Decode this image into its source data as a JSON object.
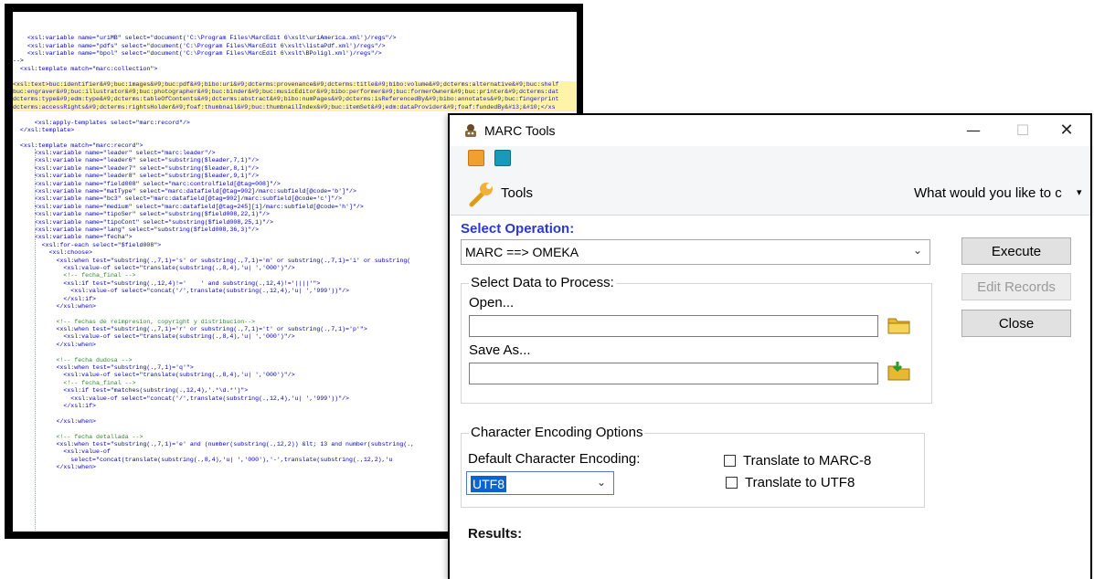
{
  "editor": {
    "lines": [
      {
        "text": "    <xsl:variable name=\"uriMB\" select=\"document('C:\\Program Files\\MarcEdit 6\\xslt\\uriAmerica.xml')/regs\"/>",
        "kind": "t"
      },
      {
        "text": "    <xsl:variable name=\"pdfs\" select=\"document('C:\\Program Files\\MarcEdit 6\\xslt\\listaPdf.xml')/regs\"/>",
        "kind": "t"
      },
      {
        "text": "    <xsl:variable name=\"bpol\" select=\"document('C:\\Program Files\\MarcEdit 6\\xslt\\BPoligl.xml')/regs\"/>",
        "kind": "t"
      },
      {
        "text": "-->",
        "kind": "b"
      },
      {
        "text": "  <xsl:template match=\"marc:collection\">",
        "kind": "t"
      },
      {
        "text": "",
        "kind": "b"
      },
      {
        "text": "<xsl:text>buc:identifier&#9;buc:images&#9;buc:pdf&#9;bibo:uri&#9;dcterms:provenance&#9;dcterms:title&#9;bibo:volume&#9;dcterms:alternative&#9;buc:shelf",
        "kind": "sel"
      },
      {
        "text": "buc:engraver&#9;buc:illustrator&#9;buc:photographer&#9;buc:binder&#9;buc:musicEditor&#9;bibo:performer&#9;buc:formerOwner&#9;buc:printer&#9;dcterms:dat",
        "kind": "sel"
      },
      {
        "text": "dcterms:type&#9;edm:type&#9;dcterms:tableOfContents&#9;dcterms:abstract&#9;bibo:numPages&#9;dcterms:isReferencedBy&#9;bibo:annotates&#9;buc:fingerprint",
        "kind": "sel"
      },
      {
        "text": "dcterms:accessRights&#9;dcterms:rightsHolder&#9;foaf:thumbnail&#9;buc:thumbnailIndex&#9;buc:itemSet&#9;edm:dataProvider&#9;foaf:fundedBy&#13;&#10;</xs",
        "kind": "sel"
      },
      {
        "text": "",
        "kind": "b"
      },
      {
        "text": "      <xsl:apply-templates select=\"marc:record\"/>",
        "kind": "t"
      },
      {
        "text": "  </xsl:template>",
        "kind": "t"
      },
      {
        "text": "",
        "kind": "b"
      },
      {
        "text": "  <xsl:template match=\"marc:record\">",
        "kind": "t"
      },
      {
        "text": "      <xsl:variable name=\"leader\" select=\"marc:leader\"/>",
        "kind": "t"
      },
      {
        "text": "      <xsl:variable name=\"leader6\" select=\"substring($leader,7,1)\"/>",
        "kind": "t"
      },
      {
        "text": "      <xsl:variable name=\"leader7\" select=\"substring($leader,8,1)\"/>",
        "kind": "t"
      },
      {
        "text": "      <xsl:variable name=\"leader8\" select=\"substring($leader,9,1)\"/>",
        "kind": "t"
      },
      {
        "text": "      <xsl:variable name=\"field008\" select=\"marc:controlfield[@tag=008]\"/>",
        "kind": "t"
      },
      {
        "text": "      <xsl:variable name=\"matType\" select=\"marc:datafield[@tag=902]/marc:subfield[@code='b']\"/>",
        "kind": "t"
      },
      {
        "text": "      <xsl:variable name=\"bc3\" select=\"marc:datafield[@tag=902]/marc:subfield[@code='c']\"/>",
        "kind": "t"
      },
      {
        "text": "      <xsl:variable name=\"medium\" select=\"marc:datafield[@tag=245][1]/marc:subfield[@code='h']\"/>",
        "kind": "t"
      },
      {
        "text": "      <xsl:variable name=\"tipoSer\" select=\"substring($field008,22,1)\"/>",
        "kind": "t"
      },
      {
        "text": "      <xsl:variable name=\"tipoCont\" select=\"substring($field008,25,1)\"/>",
        "kind": "t"
      },
      {
        "text": "      <xsl:variable name=\"lang\" select=\"substring($field008,36,3)\"/>",
        "kind": "t"
      },
      {
        "text": "      <xsl:variable name=\"fecha\">",
        "kind": "t"
      },
      {
        "text": "        <xsl:for-each select=\"$field008\">",
        "kind": "t"
      },
      {
        "text": "          <xsl:choose>",
        "kind": "t"
      },
      {
        "text": "            <xsl:when test=\"substring(.,7,1)='s' or substring(.,7,1)='m' or substring(.,7,1)='i' or substring(",
        "kind": "t"
      },
      {
        "text": "              <xsl:value-of select=\"translate(substring(.,8,4),'u| ','000')\"/>",
        "kind": "t"
      },
      {
        "text": "              <!-- fecha_final -->",
        "kind": "c"
      },
      {
        "text": "              <xsl:if test=\"substring(.,12,4)!='    ' and substring(.,12,4)!='||||'\">",
        "kind": "t"
      },
      {
        "text": "                <xsl:value-of select=\"concat('/',translate(substring(.,12,4),'u| ','999'))\"/>",
        "kind": "t"
      },
      {
        "text": "              </xsl:if>",
        "kind": "t"
      },
      {
        "text": "            </xsl:when>",
        "kind": "t"
      },
      {
        "text": "",
        "kind": "b"
      },
      {
        "text": "            <!-- fechas de reimpresion, copyright y distribucion-->",
        "kind": "c"
      },
      {
        "text": "            <xsl:when test=\"substring(.,7,1)='r' or substring(.,7,1)='t' or substring(.,7,1)='p'\">",
        "kind": "t"
      },
      {
        "text": "              <xsl:value-of select=\"translate(substring(.,8,4),'u| ','000')\"/>",
        "kind": "t"
      },
      {
        "text": "            </xsl:when>",
        "kind": "t"
      },
      {
        "text": "",
        "kind": "b"
      },
      {
        "text": "            <!-- fecha dudosa -->",
        "kind": "c"
      },
      {
        "text": "            <xsl:when test=\"substring(.,7,1)='q'\">",
        "kind": "t"
      },
      {
        "text": "              <xsl:value-of select=\"translate(substring(.,8,4),'u| ','000')\"/>",
        "kind": "t"
      },
      {
        "text": "              <!-- fecha_final -->",
        "kind": "c"
      },
      {
        "text": "              <xsl:if test=\"matches(substring(.,12,4),'.*\\d.*')\">",
        "kind": "t"
      },
      {
        "text": "                <xsl:value-of select=\"concat('/',translate(substring(.,12,4),'u| ','999'))\"/>",
        "kind": "t"
      },
      {
        "text": "              </xsl:if>",
        "kind": "t"
      },
      {
        "text": "",
        "kind": "b"
      },
      {
        "text": "            </xsl:when>",
        "kind": "t"
      },
      {
        "text": "",
        "kind": "b"
      },
      {
        "text": "            <!-- fecha detallada -->",
        "kind": "c"
      },
      {
        "text": "            <xsl:when test=\"substring(.,7,1)='e' and (number(substring(.,12,2)) &lt; 13 and number(substring(.,",
        "kind": "t"
      },
      {
        "text": "              <xsl:value-of",
        "kind": "t"
      },
      {
        "text": "                select=\"concat(translate(substring(.,8,4),'u| ','000'),'-',translate(substring(.,12,2),'u",
        "kind": "t"
      },
      {
        "text": "            </xsl:when>",
        "kind": "t"
      }
    ]
  },
  "window": {
    "title": "MARC Tools",
    "controls": {
      "minimize": "—",
      "maximize": "☐",
      "close": "✕"
    },
    "ribbon": {
      "tools_label": "Tools",
      "help_prompt": "What would you like to c"
    },
    "operation": {
      "label": "Select Operation:",
      "value": "MARC ==> OMEKA"
    },
    "data_group": {
      "title": "Select Data to Process:",
      "open_label": "Open...",
      "open_value": "",
      "save_label": "Save As...",
      "save_value": ""
    },
    "encoding_group": {
      "title": "Character Encoding Options",
      "default_label": "Default Character Encoding:",
      "default_value": "UTF8",
      "translate_marc8": "Translate to MARC-8",
      "translate_utf8": "Translate to UTF8"
    },
    "buttons": {
      "execute": "Execute",
      "edit_records": "Edit Records",
      "close": "Close"
    },
    "results_label": "Results:"
  },
  "colors": {
    "operation_label": "#2a36e0",
    "selection": "#0a64d0"
  }
}
